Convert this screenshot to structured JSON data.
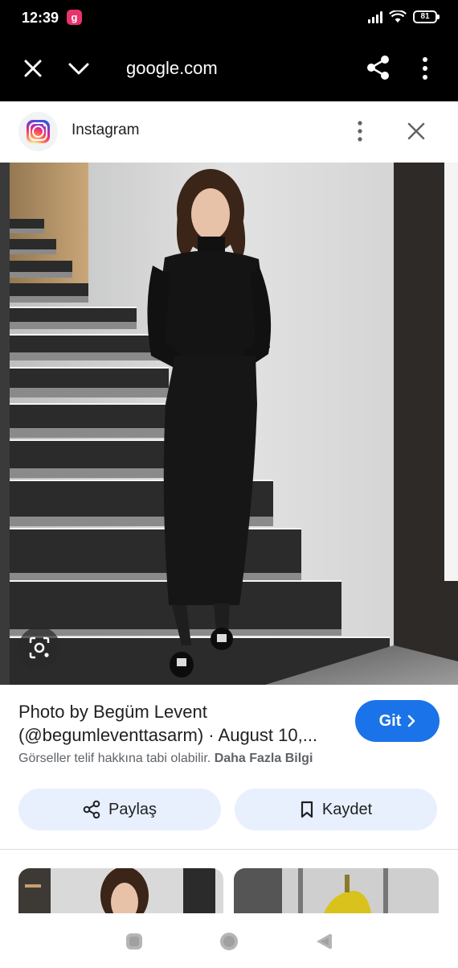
{
  "status_bar": {
    "time": "12:39",
    "app_badge": "g",
    "battery": "81"
  },
  "browser": {
    "url": "google.com"
  },
  "source": {
    "name": "Instagram"
  },
  "result": {
    "caption_line1": "Photo by Begüm Levent",
    "caption_line2": "(@begumleventtasarm) · August 10,...",
    "go_label": "Git",
    "copyright_text": "Görseller telif hakkına tabi olabilir.",
    "more_info_link": "Daha Fazla Bilgi",
    "share_label": "Paylaş",
    "save_label": "Kaydet"
  },
  "icons": {
    "close": "close-icon",
    "collapse": "chevron-down-icon",
    "share": "share-icon",
    "more": "more-vert-icon",
    "lens": "lens-icon",
    "bookmark": "bookmark-icon"
  },
  "colors": {
    "accent": "#1a73e8",
    "button_bg": "#e8f0fe",
    "bar_bg": "#000000"
  }
}
